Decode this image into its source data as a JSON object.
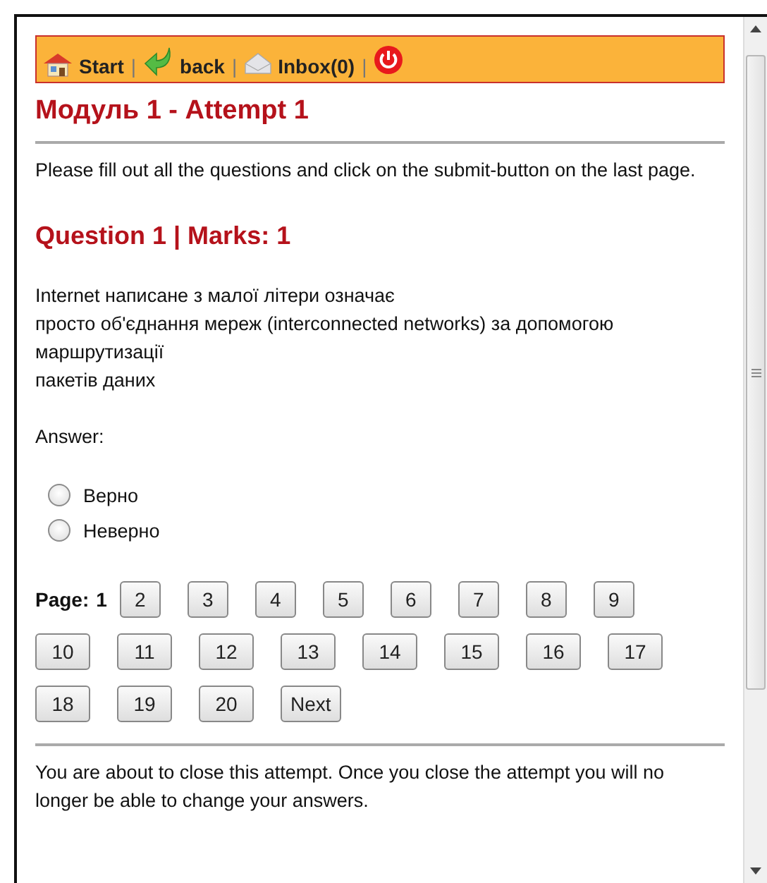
{
  "nav": {
    "items": [
      {
        "kind": "home",
        "label": "Start",
        "separator": "|"
      },
      {
        "kind": "back",
        "label": "back",
        "separator": "|"
      },
      {
        "kind": "mail",
        "label": "Inbox(0)",
        "separator": "|"
      },
      {
        "kind": "power"
      }
    ]
  },
  "title": "Модуль 1 - Attempt 1",
  "instructions": "Please fill out all the questions and click on the submit-button on the last page.",
  "question": {
    "heading": "Question 1 | Marks: 1",
    "text_lines": [
      "Internet написане з малої літери означає",
      "просто об'єднання мереж (interconnected networks) за допомогою маршрутизації",
      "пакетів даних"
    ],
    "answer_label": "Answer:",
    "options": [
      {
        "label": "Верно",
        "selected": false
      },
      {
        "label": "Неверно",
        "selected": false
      }
    ]
  },
  "pagination": {
    "label": "Page:",
    "pages": [
      {
        "label": "1",
        "selected": true
      },
      {
        "label": "2",
        "selected": false
      },
      {
        "label": "3",
        "selected": false
      },
      {
        "label": "4",
        "selected": false
      },
      {
        "label": "5",
        "selected": false
      },
      {
        "label": "6",
        "selected": false
      },
      {
        "label": "7",
        "selected": false
      },
      {
        "label": "8",
        "selected": false
      },
      {
        "label": "9",
        "selected": false
      },
      {
        "label": "10",
        "selected": false
      },
      {
        "label": "11",
        "selected": false
      },
      {
        "label": "12",
        "selected": false
      },
      {
        "label": "13",
        "selected": false
      },
      {
        "label": "14",
        "selected": false
      },
      {
        "label": "15",
        "selected": false
      },
      {
        "label": "16",
        "selected": false
      },
      {
        "label": "17",
        "selected": false
      },
      {
        "label": "18",
        "selected": false
      },
      {
        "label": "19",
        "selected": false
      },
      {
        "label": "20",
        "selected": false
      }
    ],
    "next": "Next"
  },
  "close_notice": "You are about to close this attempt. Once you close the attempt you will no longer be able to change your answers."
}
